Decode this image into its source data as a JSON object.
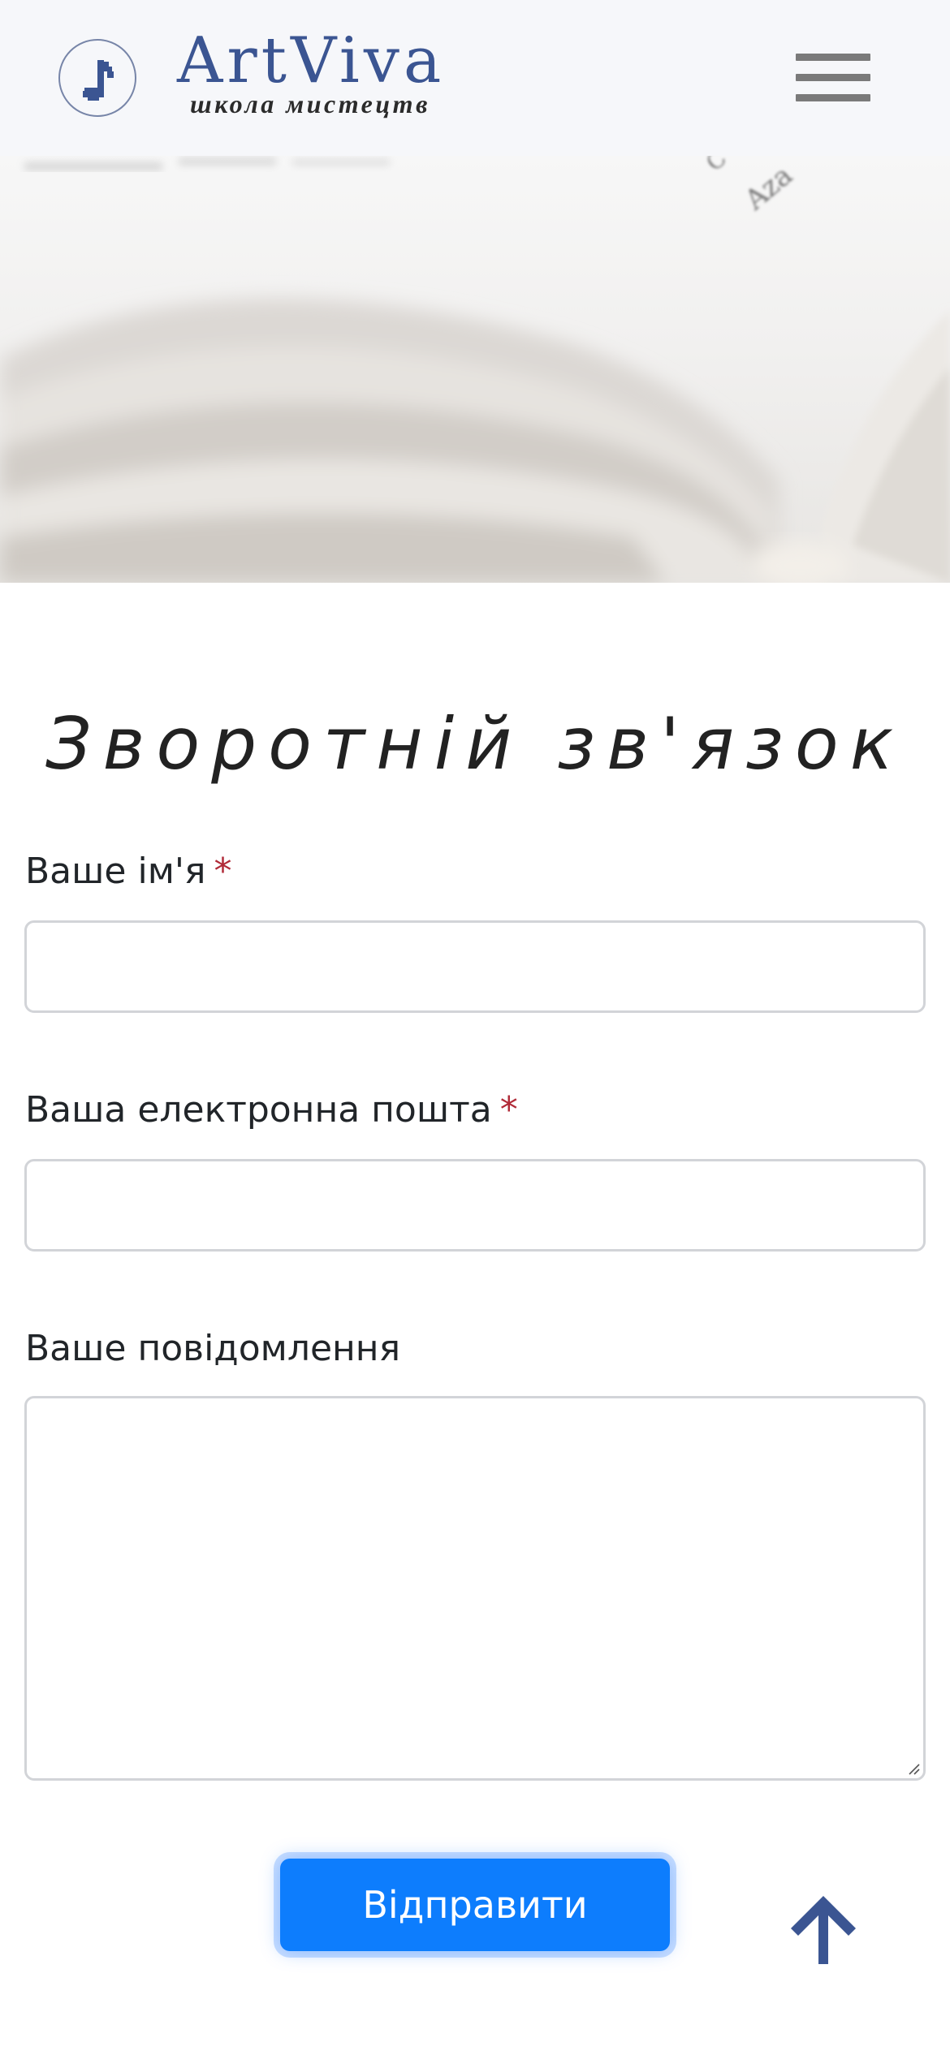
{
  "header": {
    "brand_name": "ArtViva",
    "brand_subtitle": "школа мистецтв",
    "logo_icon": "music-note-icon",
    "menu_icon": "hamburger-menu-icon",
    "brand_color": "#3b5592"
  },
  "hero": {
    "image": "open-book-photo",
    "corner_text": "Aza"
  },
  "form": {
    "title": "Зворотній зв'язок",
    "name_label": "Ваше ім'я",
    "name_value": "",
    "email_label": "Ваша електронна пошта",
    "email_value": "",
    "message_label": "Ваше повідомлення",
    "message_value": "",
    "required_mark": "*",
    "submit_label": "Відправити",
    "submit_color": "#0d7dfd",
    "required_color": "#b02a37"
  },
  "scroll_top": {
    "icon": "arrow-up-icon",
    "color": "#3b5592"
  }
}
